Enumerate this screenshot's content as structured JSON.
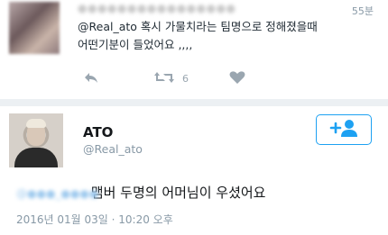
{
  "reply_tweet": {
    "time": "55분",
    "mention": "@Real_ato",
    "line1_rest": " 혹시 가물치라는 팀명으로 정해졌을때",
    "line2": "어떤기분이 들었어요 ,,,,",
    "retweet_count": "6",
    "icons": {
      "reply": "reply-icon",
      "retweet": "retweet-icon",
      "like": "heart-icon"
    }
  },
  "main_tweet": {
    "display_name": "ATO",
    "handle": "@Real_ato",
    "text": "맴버 두명의 어머님이 우셨어요",
    "timestamp": "2016년 01월 03일 · 10:20 오후",
    "follow_icon": "add-user-icon"
  },
  "colors": {
    "accent": "#1da1f2",
    "muted": "#8899a6",
    "divider": "#ecf0f3"
  }
}
